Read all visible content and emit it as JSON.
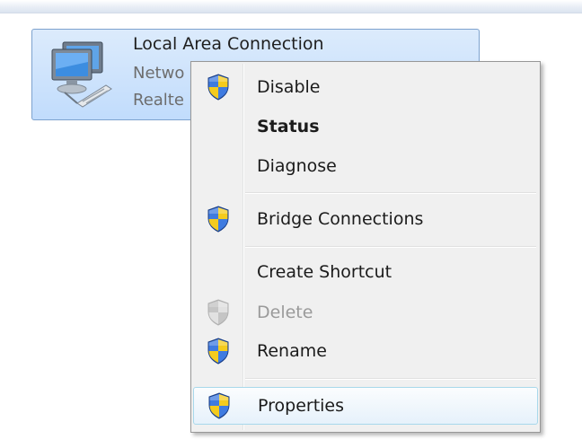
{
  "connection": {
    "name": "Local Area Connection",
    "status": "Netwo",
    "adapter": "Realte",
    "icon": "network-adapter-icon"
  },
  "context_menu": {
    "items": [
      {
        "label": "Disable",
        "icon": "uac-shield-icon"
      },
      {
        "label": "Status",
        "default": true
      },
      {
        "label": "Diagnose"
      },
      {
        "label": "Bridge Connections",
        "icon": "uac-shield-icon"
      },
      {
        "label": "Create Shortcut"
      },
      {
        "label": "Delete",
        "icon": "uac-shield-icon",
        "disabled": true
      },
      {
        "label": "Rename",
        "icon": "uac-shield-icon"
      },
      {
        "label": "Properties",
        "icon": "uac-shield-icon",
        "highlighted": true
      }
    ]
  },
  "colors": {
    "selection_fill": "#c1dcfc",
    "selection_border": "#7da2ce",
    "menu_background": "#f0f0f0",
    "menu_highlight_border": "#a8d8eb",
    "shield_blue": "#2f63c8",
    "shield_yellow": "#f2c414"
  }
}
